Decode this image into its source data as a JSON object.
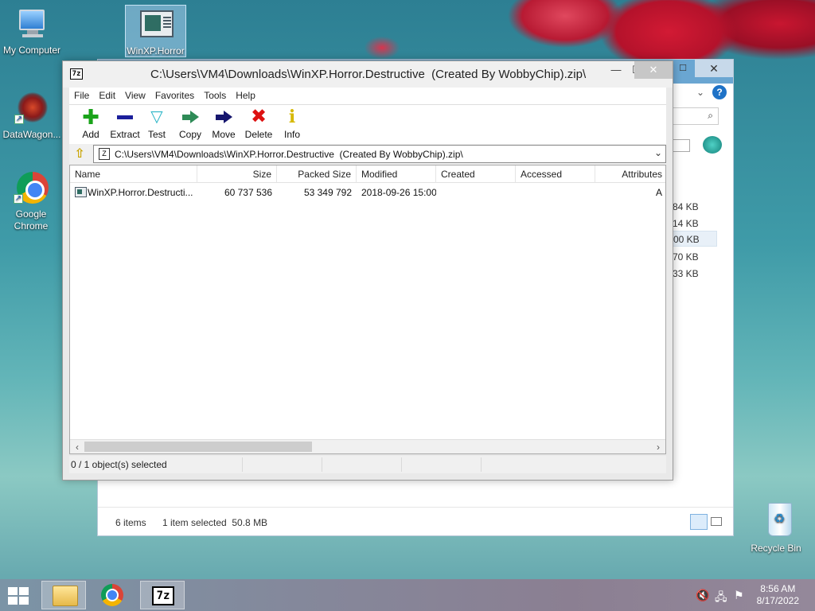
{
  "desktop": {
    "icons": [
      {
        "label": "My Computer"
      },
      {
        "label": "DataWagon..."
      },
      {
        "label": "Google Chrome"
      },
      {
        "label": "WinXP.Horror"
      },
      {
        "label": "Recycle Bin"
      }
    ]
  },
  "explorer": {
    "close_glyph": "✕",
    "max_glyph": "☐",
    "size_fragments": [
      "84 KB",
      "14 KB",
      "00 KB",
      "70 KB",
      "33 KB"
    ],
    "status_items": "6 items",
    "status_selected": "1 item selected  50.8 MB"
  },
  "sevenzip": {
    "app_icon": "7z",
    "title": "C:\\Users\\VM4\\Downloads\\WinXP.Horror.Destructive  (Created By WobbyChip).zip\\",
    "min_glyph": "—",
    "max_glyph": "☐",
    "close_glyph": "✕",
    "menu": [
      "File",
      "Edit",
      "View",
      "Favorites",
      "Tools",
      "Help"
    ],
    "toolbar": [
      {
        "label": "Add",
        "icon": "add-icon"
      },
      {
        "label": "Extract",
        "icon": "extract-icon"
      },
      {
        "label": "Test",
        "icon": "test-icon"
      },
      {
        "label": "Copy",
        "icon": "copy-icon"
      },
      {
        "label": "Move",
        "icon": "move-icon"
      },
      {
        "label": "Delete",
        "icon": "delete-icon"
      },
      {
        "label": "Info",
        "icon": "info-icon"
      }
    ],
    "address": "C:\\Users\\VM4\\Downloads\\WinXP.Horror.Destructive  (Created By WobbyChip).zip\\",
    "columns": [
      "Name",
      "Size",
      "Packed Size",
      "Modified",
      "Created",
      "Accessed",
      "Attributes"
    ],
    "rows": [
      {
        "name": "WinXP.Horror.Destructi...",
        "size": "60 737 536",
        "packed": "53 349 792",
        "modified": "2018-09-26 15:00",
        "created": "",
        "accessed": "",
        "attributes": "A"
      }
    ],
    "status": "0 / 1 object(s) selected"
  },
  "taskbar": {
    "clock_time": "8:56 AM",
    "clock_date": "8/17/2022"
  }
}
